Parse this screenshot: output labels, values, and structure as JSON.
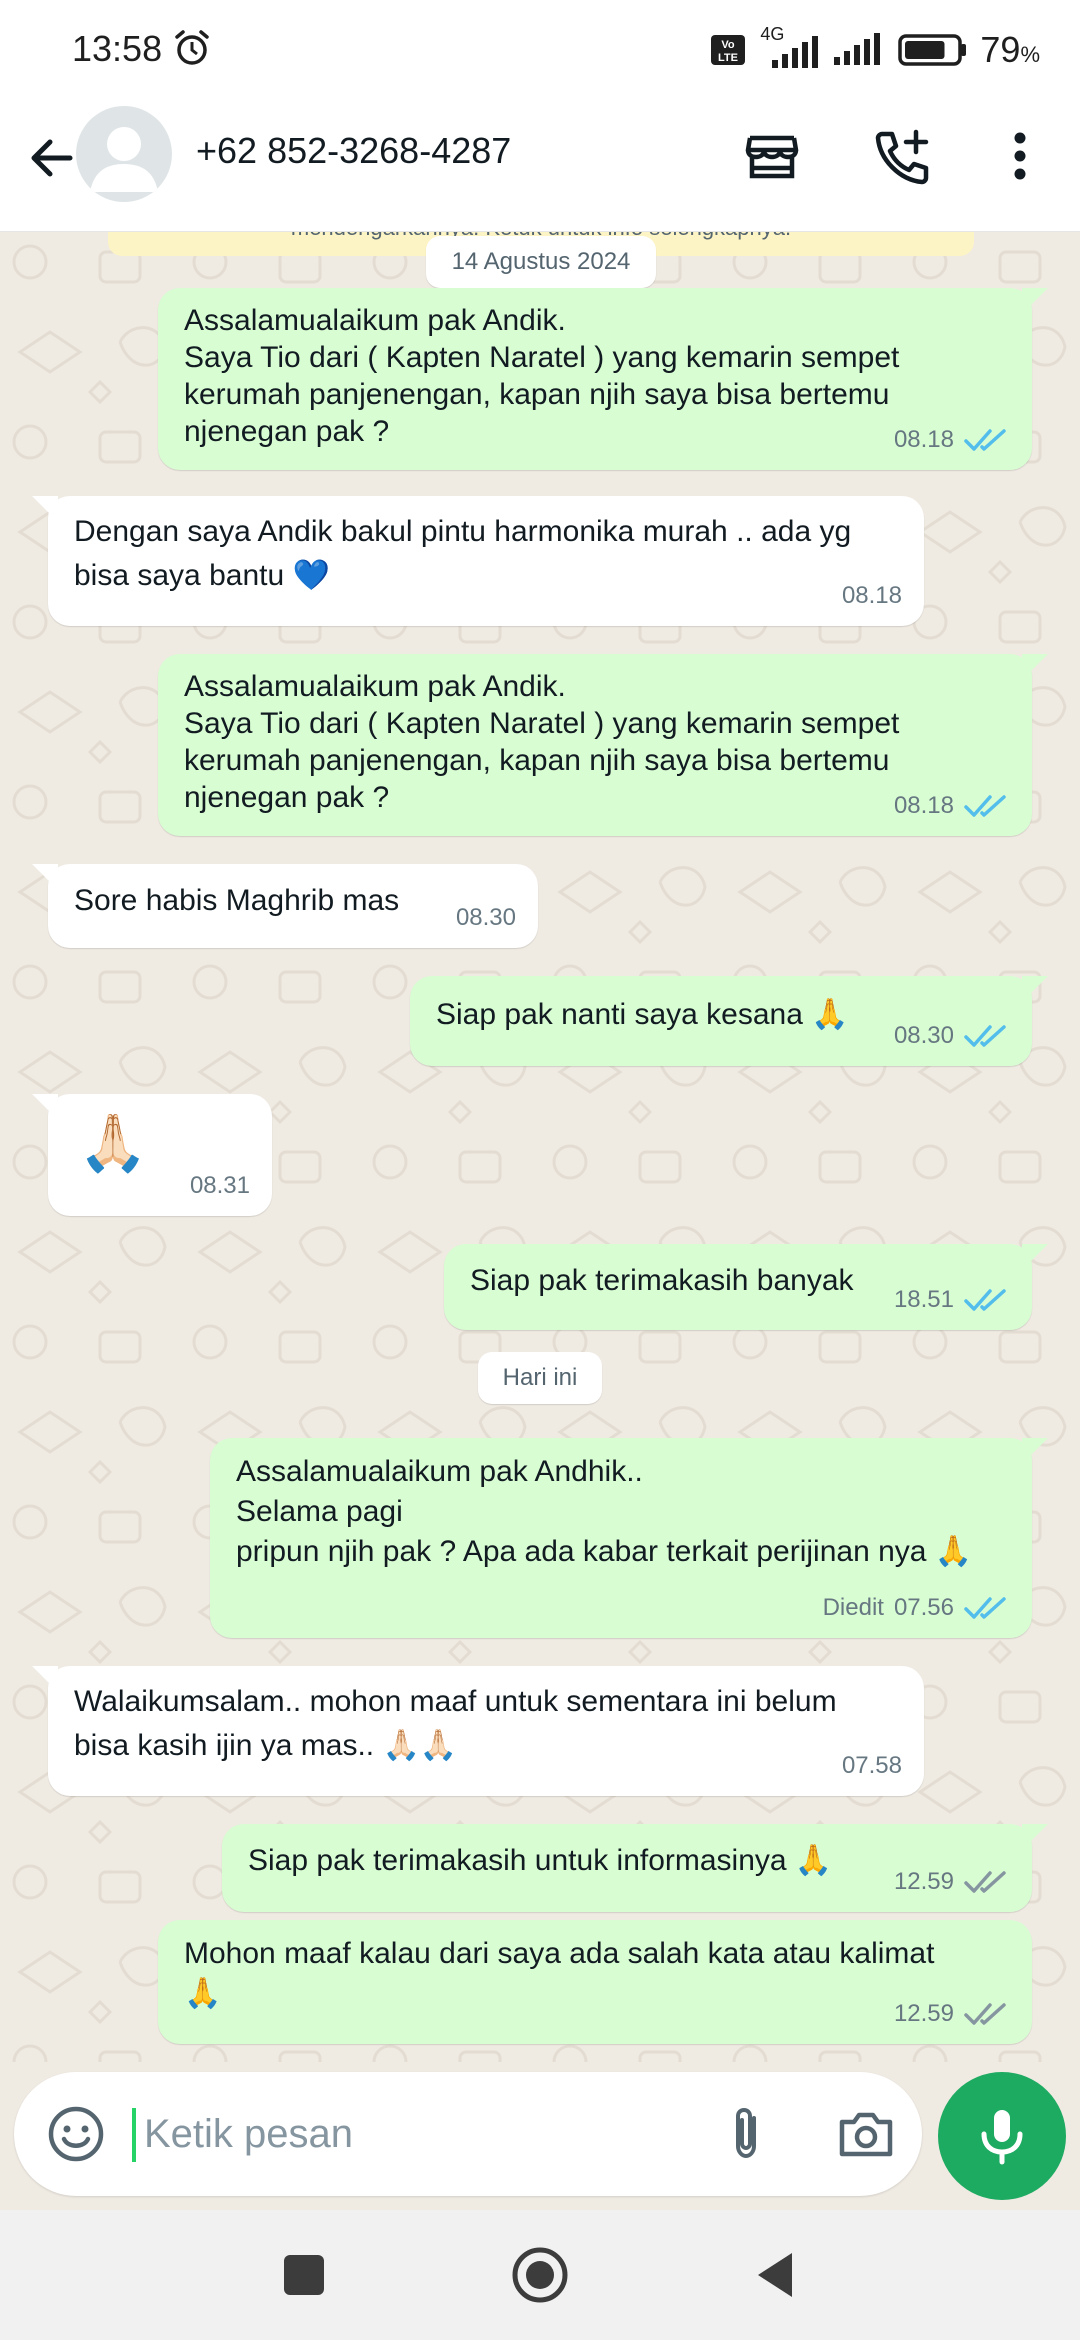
{
  "status_bar": {
    "time": "13:58",
    "network": "4G",
    "volte": "Vo LTE",
    "battery_percent": "79",
    "battery_unit": "%",
    "battery_level": 0.79
  },
  "header": {
    "contact_name": "+62 852-3268-4287"
  },
  "chat": {
    "system_note": "mendengarkannya. Ketuk untuk info selengkapnya.",
    "messages": [
      {
        "kind": "date",
        "label": "14 Agustus 2024"
      },
      {
        "kind": "out",
        "text": "Assalamualaikum pak Andik.\nSaya Tio dari ( Kapten Naratel ) yang kemarin sempet kerumah panjenengan, kapan njih saya bisa bertemu njenegan pak ?",
        "time": "08.18",
        "status": "read"
      },
      {
        "kind": "in",
        "text": "Dengan saya Andik bakul pintu harmonika murah .. ada yg bisa saya bantu 💙",
        "time": "08.18"
      },
      {
        "kind": "out",
        "text": "Assalamualaikum pak Andik.\nSaya Tio dari ( Kapten Naratel ) yang kemarin sempet kerumah panjenengan, kapan njih saya bisa bertemu njenegan pak ?",
        "time": "08.18",
        "status": "read"
      },
      {
        "kind": "in",
        "text": "Sore habis Maghrib mas",
        "time": "08.30"
      },
      {
        "kind": "out",
        "text": "Siap pak nanti saya kesana 🙏",
        "time": "08.30",
        "status": "read"
      },
      {
        "kind": "in",
        "text": "🙏🏻",
        "time": "08.31"
      },
      {
        "kind": "out",
        "text": "Siap pak terimakasih banyak",
        "time": "18.51",
        "status": "read"
      },
      {
        "kind": "date",
        "label": "Hari ini"
      },
      {
        "kind": "out",
        "text": "Assalamualaikum pak Andhik..\nSelama pagi\npripun njih pak ? Apa ada kabar terkait perijinan nya 🙏",
        "edited_label": "Diedit",
        "time": "07.56",
        "status": "read"
      },
      {
        "kind": "in",
        "text": "Walaikumsalam.. mohon maaf untuk sementara ini belum bisa kasih ijin ya mas.. 🙏🏻🙏🏻",
        "time": "07.58"
      },
      {
        "kind": "out",
        "text": "Siap pak terimakasih untuk informasinya 🙏",
        "time": "12.59",
        "status": "delivered"
      },
      {
        "kind": "out",
        "text": "Mohon maaf kalau dari saya ada salah kata atau kalimat\n🙏",
        "time": "12.59",
        "status": "delivered"
      }
    ]
  },
  "composer": {
    "placeholder": "Ketik pesan"
  },
  "icons": {
    "back": "arrow-back-icon",
    "store": "store-icon",
    "call_add": "call-add-icon",
    "menu": "more-vert-icon",
    "emoji": "emoji-icon",
    "attach": "paperclip-icon",
    "camera": "camera-icon",
    "mic": "microphone-icon"
  },
  "colors": {
    "outgoing_bubble": "#d9fdd3",
    "incoming_bubble": "#ffffff",
    "chat_background": "#efeae2",
    "read_ticks": "#53bdeb",
    "delivered_ticks": "#8696a0",
    "mic_button": "#1daa61"
  }
}
